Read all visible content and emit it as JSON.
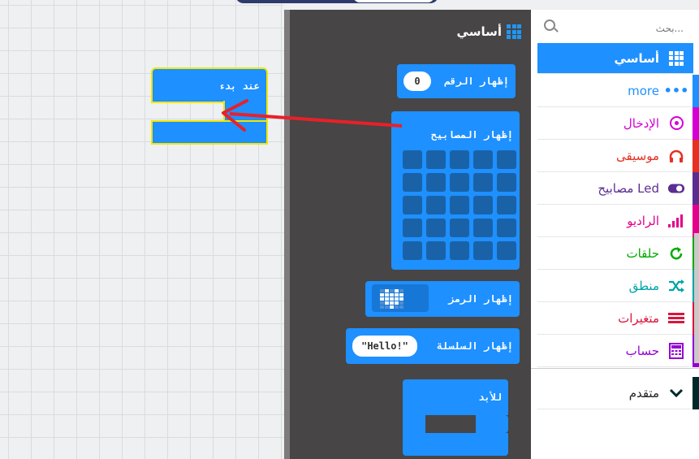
{
  "workspace": {
    "on_start_label": "عند بدء"
  },
  "flyout": {
    "title": "أساسي",
    "blocks": {
      "show_number_label": "إظهار الرقم",
      "show_number_value": "0",
      "show_leds_label": "إظهار المصابيح",
      "show_icon_label": "إظهار الرمز",
      "show_string_label": "إظهار السلسلة",
      "show_string_value": "\"Hello!\"",
      "forever_label": "للأبد"
    }
  },
  "sidebar": {
    "search_placeholder": "بحث...",
    "items": [
      {
        "label": "أساسي",
        "icon": "grid-icon",
        "color": "#1e90ff"
      },
      {
        "label": "more",
        "icon": "more-icon",
        "color": "#1e90ff"
      },
      {
        "label": "الإدخال",
        "icon": "target-icon",
        "color": "#d400d4"
      },
      {
        "label": "موسيقى",
        "icon": "headphones-icon",
        "color": "#e63022"
      },
      {
        "label": "مصابيح Led",
        "icon": "toggle-icon",
        "color": "#5c2d91"
      },
      {
        "label": "الراديو",
        "icon": "signal-icon",
        "color": "#e3008c"
      },
      {
        "label": "حلقات",
        "icon": "refresh-icon",
        "color": "#00aa00"
      },
      {
        "label": "منطق",
        "icon": "shuffle-icon",
        "color": "#00a4a6"
      },
      {
        "label": "متغيرات",
        "icon": "list-icon",
        "color": "#dc143c"
      },
      {
        "label": "حساب",
        "icon": "calculator-icon",
        "color": "#9400d3"
      },
      {
        "label": "متقدم",
        "icon": "chevron-down-icon",
        "color": "#00272b"
      }
    ]
  }
}
